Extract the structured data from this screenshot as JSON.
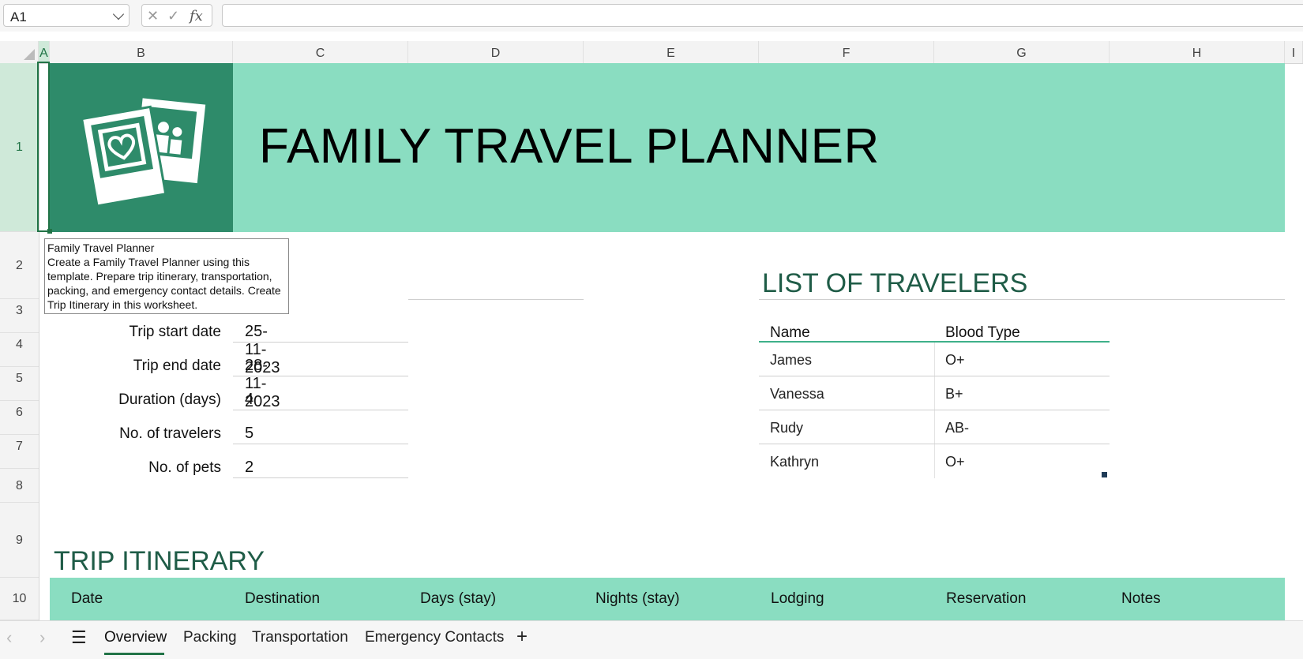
{
  "formula_bar": {
    "name_box": "A1",
    "formula": ""
  },
  "columns": [
    "A",
    "B",
    "C",
    "D",
    "E",
    "F",
    "G",
    "H",
    "I"
  ],
  "rows": [
    "1",
    "2",
    "3",
    "4",
    "5",
    "6",
    "7",
    "8",
    "9",
    "10"
  ],
  "banner": {
    "title": "FAMILY TRAVEL PLANNER"
  },
  "tooltip": {
    "title": "Family Travel Planner",
    "lines": [
      "Create a Family Travel Planner using this",
      "template. Prepare trip itinerary, transportation,",
      "packing, and emergency contact details. Create",
      "Trip Itinerary in this worksheet."
    ]
  },
  "trip": [
    {
      "label": "Trip start date",
      "value": "25-11-2023"
    },
    {
      "label": "Trip end date",
      "value": "28-11-2023"
    },
    {
      "label": "Duration (days)",
      "value": "4"
    },
    {
      "label": "No. of travelers",
      "value": "5"
    },
    {
      "label": "No. of pets",
      "value": "2"
    }
  ],
  "travelers": {
    "heading": "LIST OF TRAVELERS",
    "headers": [
      "Name",
      "Blood Type"
    ],
    "rows": [
      [
        "James",
        "O+"
      ],
      [
        "Vanessa",
        "B+"
      ],
      [
        "Rudy",
        "AB-"
      ],
      [
        "Kathryn",
        "O+"
      ]
    ]
  },
  "itinerary": {
    "heading": "TRIP ITINERARY",
    "headers": [
      "Date",
      "Destination",
      "Days (stay)",
      "Nights (stay)",
      "Lodging",
      "Reservation",
      "Notes"
    ]
  },
  "sheet_tabs": [
    "Overview",
    "Packing",
    "Transportation",
    "Emergency Contacts"
  ],
  "colors": {
    "banner": "#8addc1",
    "logo_bg": "#2e8b6a",
    "heading": "#1f5c47",
    "accent": "#217346"
  }
}
